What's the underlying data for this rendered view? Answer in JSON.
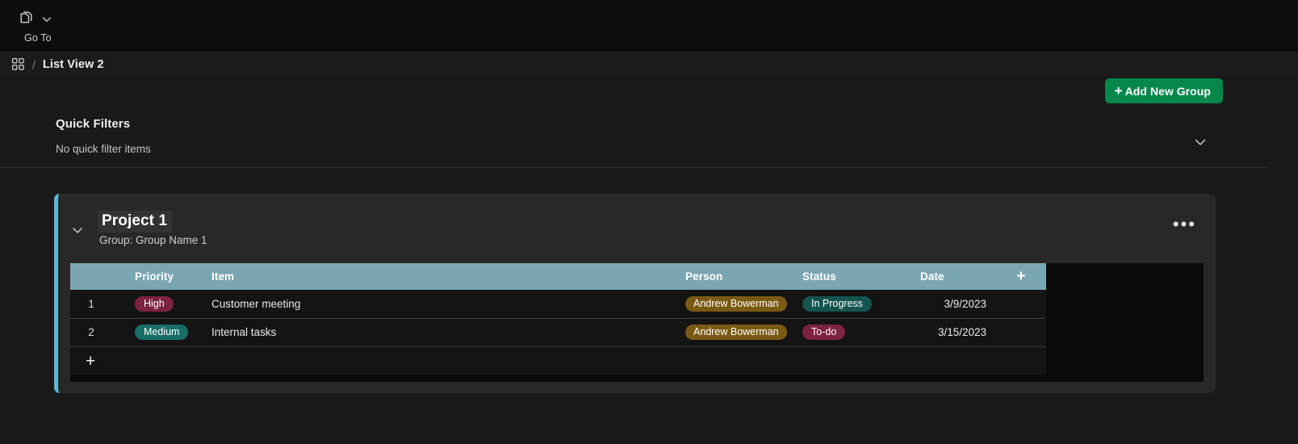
{
  "topbar": {
    "goto_icon": "copy-documents-icon",
    "goto_chevron_icon": "chevron-down-icon",
    "goto_label": "Go To"
  },
  "breadcrumb": {
    "grid_icon": "grid-apps-icon",
    "separator": "/",
    "title": "List View 2"
  },
  "toolbar": {
    "add_group_plus": "+",
    "add_group_label": "Add New Group",
    "add_group_color": "#05874b"
  },
  "quick_filters": {
    "title": "Quick Filters",
    "empty_text": "No quick filter items",
    "collapse_icon": "chevron-down-icon"
  },
  "project_card": {
    "accent_color": "#5bb8d4",
    "collapse_icon": "chevron-down-icon",
    "title": "Project 1",
    "subtitle": "Group: Group Name 1",
    "menu_icon": "more-horizontal-icon",
    "menu_glyph": "•••",
    "add_column_glyph": "+",
    "add_row_glyph": "+",
    "header_color": "#7aa6b3",
    "columns": [
      {
        "key": "num",
        "label": ""
      },
      {
        "key": "pri",
        "label": "Priority"
      },
      {
        "key": "item",
        "label": "Item"
      },
      {
        "key": "per",
        "label": "Person"
      },
      {
        "key": "sta",
        "label": "Status"
      },
      {
        "key": "dat",
        "label": "Date"
      },
      {
        "key": "plus",
        "label": "+"
      }
    ],
    "rows": [
      {
        "num": "1",
        "priority": "High",
        "priority_color": "#7d2240",
        "item": "Customer meeting",
        "person": "Andrew Bowerman",
        "person_color": "#7a5a12",
        "status": "In Progress",
        "status_color": "#14544f",
        "date": "3/9/2023"
      },
      {
        "num": "2",
        "priority": "Medium",
        "priority_color": "#186e66",
        "item": "Internal tasks",
        "person": "Andrew Bowerman",
        "person_color": "#7a5a12",
        "status": "To-do",
        "status_color": "#7d2240",
        "date": "3/15/2023"
      }
    ]
  }
}
